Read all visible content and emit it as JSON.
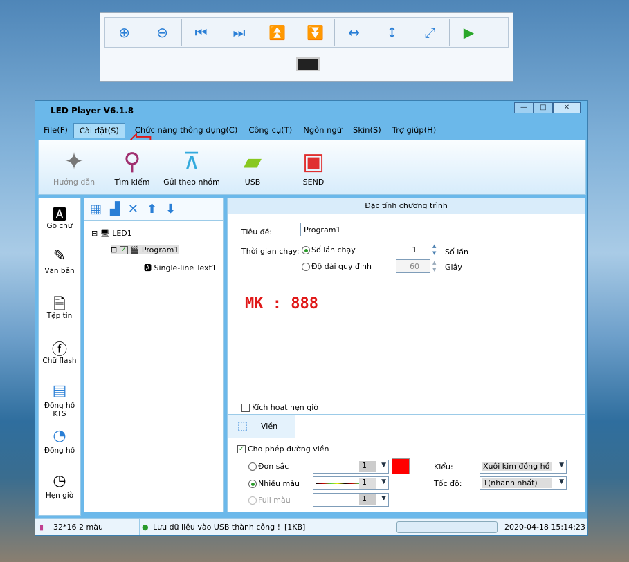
{
  "float_toolbar": {
    "buttons": [
      "zoom-in",
      "zoom-out",
      "first",
      "last",
      "top",
      "bottom",
      "fit-width",
      "fit-height",
      "fit-all",
      "play"
    ]
  },
  "window": {
    "title": "LED Player V6.1.8"
  },
  "menu": [
    "File(F)",
    "Cài đặt(S)",
    "Chức năng thông dụng(C)",
    "Công cụ(T)",
    "Ngôn ngữ",
    "Skin(S)",
    "Trợ giúp(H)"
  ],
  "ribbon": [
    "Hướng dẫn",
    "Tìm kiếm",
    "Gửi theo nhóm",
    "USB",
    "SEND"
  ],
  "left_items": [
    "Gõ chữ",
    "Văn bản",
    "Tệp tin",
    "Chữ flash",
    "Đồng hồ KTS",
    "Đồng hồ",
    "Hẹn giờ"
  ],
  "tree": {
    "root": "LED1",
    "program": "Program1",
    "item": "Single-line Text1"
  },
  "props": {
    "header": "Đặc tính chương trình",
    "title_label": "Tiêu đề:",
    "title_value": "Program1",
    "runtime_label": "Thời gian chạy:",
    "opt1": "Số lần chạy",
    "opt1_value": "1",
    "opt1_unit": "Số lần",
    "opt2": "Độ dài quy định",
    "opt2_value": "60",
    "opt2_unit": "Giây",
    "schedule": "Kích hoạt hẹn giờ",
    "annotation": "MK : 888"
  },
  "border": {
    "tab": "Viền",
    "enable": "Cho phép đường viền",
    "single": "Đơn sắc",
    "multi": "Nhiều màu",
    "full": "Full màu",
    "width_value": "1",
    "color": "#ff0000",
    "style_label": "Kiểu:",
    "style_value": "Xuôi kim đồng hồ",
    "speed_label": "Tốc độ:",
    "speed_value": "1(nhanh nhất)"
  },
  "status": {
    "screen": "32*16 2 màu",
    "message": "Lưu dữ liệu vào USB thành công !",
    "size": "[1KB]",
    "datetime": "2020-04-18 15:14:23"
  }
}
